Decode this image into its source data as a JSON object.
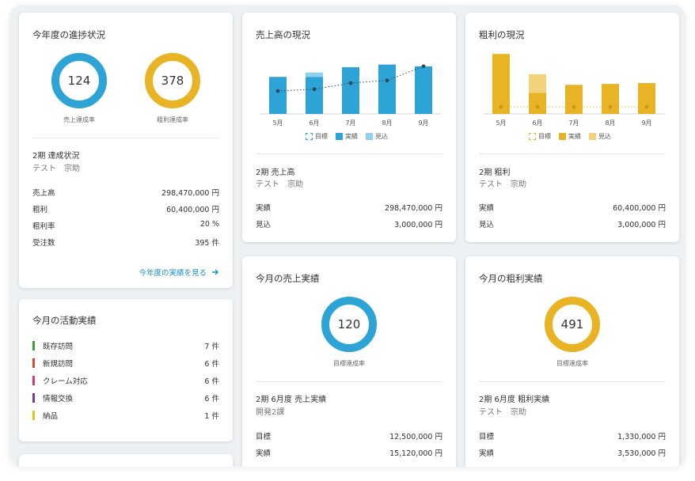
{
  "progress": {
    "title": "今年度の進捗状況",
    "sales_rate": {
      "value": "124",
      "caption": "売上達成率",
      "percent": 100
    },
    "profit_rate": {
      "value": "378",
      "caption": "粗利達成率",
      "percent": 100
    },
    "period": "2期 達成状況",
    "person": "テスト　宗助",
    "rows": [
      {
        "label": "売上高",
        "value": "298,470,000 円"
      },
      {
        "label": "粗利",
        "value": "60,400,000 円"
      },
      {
        "label": "粗利率",
        "value": "20 %"
      },
      {
        "label": "受注数",
        "value": "395 件"
      }
    ],
    "link": "今年度の実績を見る"
  },
  "activity": {
    "title": "今月の活動実績",
    "items": [
      {
        "label": "既存訪問",
        "count": "7 件",
        "color": "#3aa33a"
      },
      {
        "label": "新規訪問",
        "count": "6 件",
        "color": "#e0482e"
      },
      {
        "label": "クレーム対応",
        "count": "6 件",
        "color": "#d23a7a"
      },
      {
        "label": "情報交換",
        "count": "6 件",
        "color": "#7a3a9a"
      },
      {
        "label": "納品",
        "count": "1 件",
        "color": "#e8c21e"
      }
    ]
  },
  "sales_status": {
    "title": "売上高の現況",
    "legend": [
      "目標",
      "実績",
      "見込"
    ],
    "period": "2期 売上高",
    "person": "テスト　宗助",
    "rows": [
      {
        "label": "実績",
        "value": "298,470,000 円"
      },
      {
        "label": "見込",
        "value": "3,000,000 円"
      }
    ]
  },
  "profit_status": {
    "title": "粗利の現況",
    "legend": [
      "目標",
      "実績",
      "見込"
    ],
    "period": "2期 粗利",
    "person": "テスト　宗助",
    "rows": [
      {
        "label": "実績",
        "value": "60,400,000 円"
      },
      {
        "label": "見込",
        "value": "3,000,000 円"
      }
    ]
  },
  "month_sales": {
    "title": "今月の売上実績",
    "rate": {
      "value": "120",
      "caption": "目標達成率",
      "percent": 100
    },
    "period": "2期 6月度 売上実績",
    "person": "開発2課",
    "rows": [
      {
        "label": "目標",
        "value": "12,500,000 円"
      },
      {
        "label": "実績",
        "value": "15,120,000 円"
      }
    ]
  },
  "month_profit": {
    "title": "今月の粗利実績",
    "rate": {
      "value": "491",
      "caption": "目標達成率",
      "percent": 100
    },
    "period": "2期 6月度 粗利実績",
    "person": "テスト　宗助",
    "rows": [
      {
        "label": "目標",
        "value": "1,330,000 円"
      },
      {
        "label": "実績",
        "value": "3,530,000 円"
      }
    ]
  },
  "colors": {
    "blue": "#2ea3d6",
    "blue_light": "#8fd0ee",
    "gold": "#e8b325",
    "gold_light": "#f2d27d",
    "dark_dot": "#2b4a63"
  },
  "chart_data": [
    {
      "type": "bar",
      "categories": [
        "5月",
        "6月",
        "7月",
        "8月",
        "9月"
      ],
      "series": [
        {
          "name": "実績",
          "values": [
            42,
            42,
            53,
            56,
            54
          ]
        },
        {
          "name": "見込",
          "values": [
            0,
            5,
            0,
            0,
            0
          ]
        },
        {
          "name": "目標",
          "values": [
            26,
            28,
            35,
            38,
            54
          ]
        }
      ],
      "ylim": [
        0,
        70
      ],
      "grid": false,
      "legend": "bottom"
    },
    {
      "type": "bar",
      "categories": [
        "5月",
        "6月",
        "7月",
        "8月",
        "9月"
      ],
      "series": [
        {
          "name": "実績",
          "values": [
            68,
            24,
            33,
            34,
            35
          ]
        },
        {
          "name": "見込",
          "values": [
            0,
            21,
            0,
            0,
            0
          ]
        },
        {
          "name": "目標",
          "values": [
            8,
            8,
            8,
            8,
            8
          ]
        }
      ],
      "ylim": [
        0,
        70
      ],
      "grid": false,
      "legend": "bottom"
    }
  ]
}
